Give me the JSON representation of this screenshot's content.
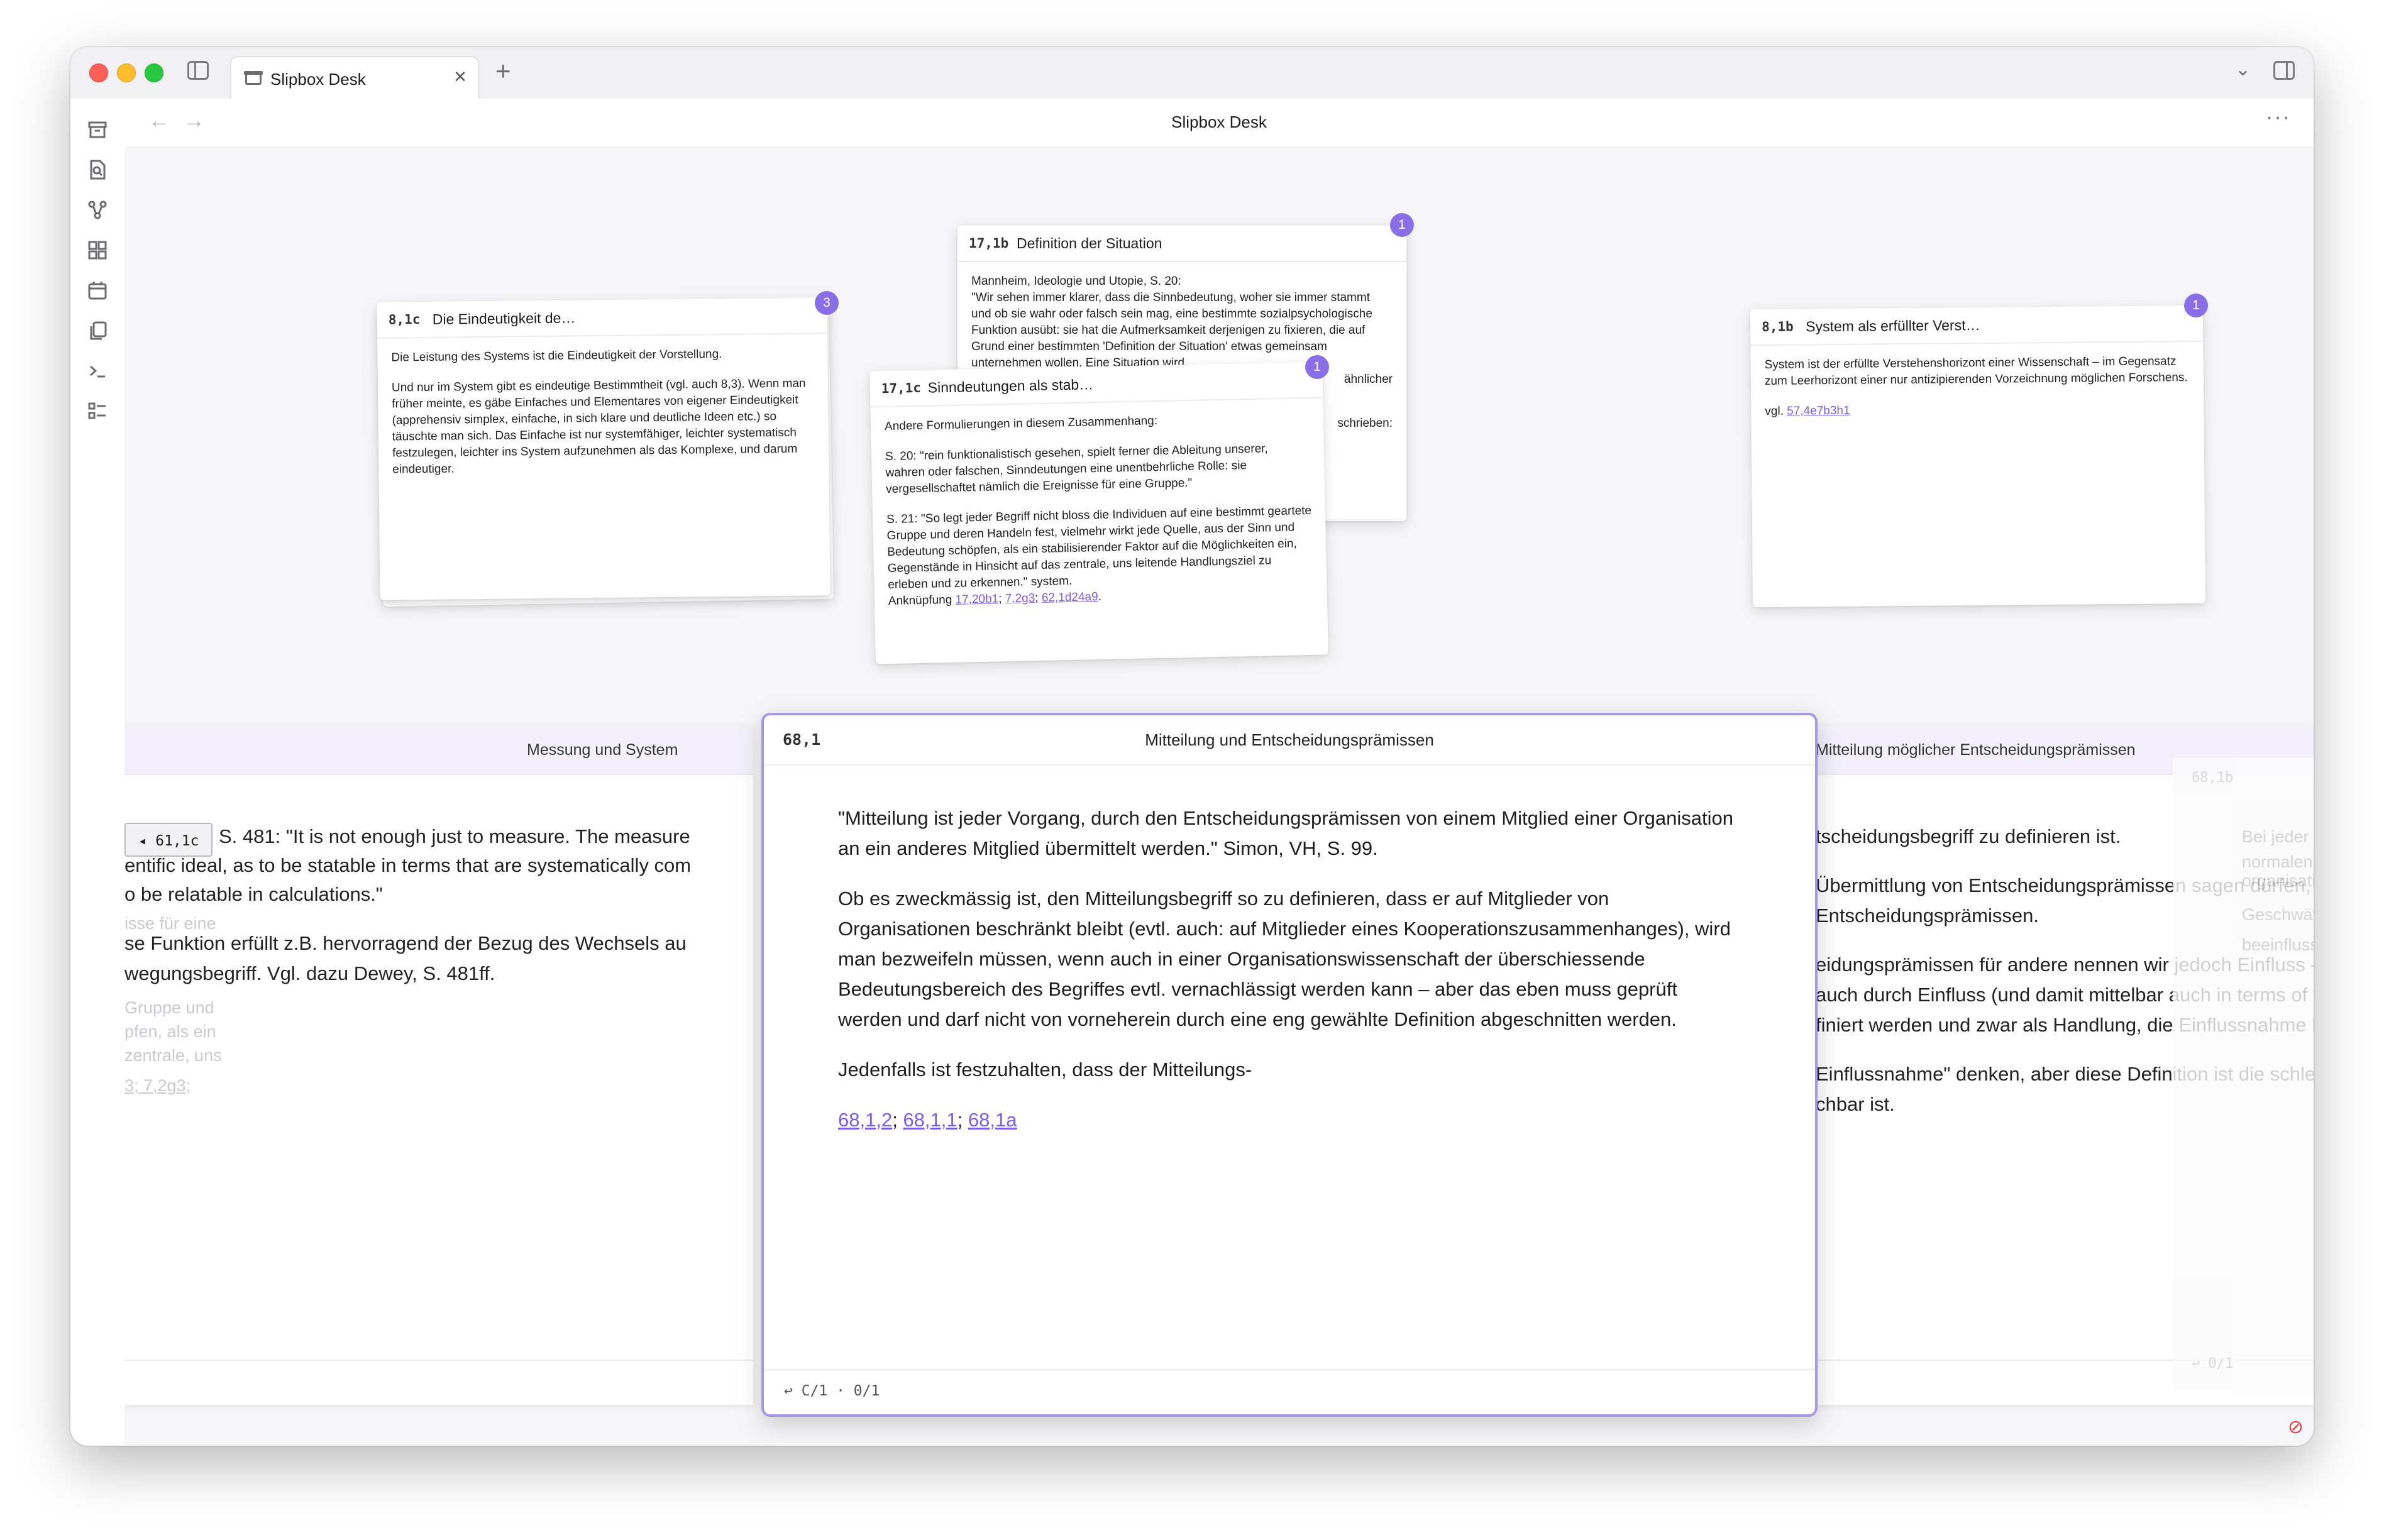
{
  "window": {
    "tab_title": "Slipbox Desk",
    "header_title": "Slipbox Desk"
  },
  "icons": {
    "tab": "archive-icon",
    "ribbon": [
      "archive-icon",
      "search-file-icon",
      "graph-icon",
      "grid-icon",
      "calendar-icon",
      "copy-icon",
      "terminal-icon",
      "list-icon"
    ]
  },
  "cards": [
    {
      "id": "8,1c",
      "title": "Die Eindeutigkeit de…",
      "badge": "3",
      "paragraphs": [
        "Die Leistung des Systems ist die Eindeutigkeit der Vorstellung.",
        "Und nur im System gibt es eindeutige Bestimmtheit (vgl. auch 8,3). Wenn man früher meinte, es gäbe Einfaches und Elementares von eigener Eindeutigkeit (apprehensiv simplex, einfache, in sich klare und deutliche Ideen etc.) so täuschte man sich. Das Einfache ist nur systemfähiger, leichter systematisch festzulegen, leichter ins System aufzunehmen als das Komplexe, und darum eindeutiger."
      ]
    },
    {
      "id": "17,1b",
      "title": "Definition der Situation",
      "badge": "1",
      "paragraphs": [
        "Mannheim, Ideologie und Utopie, S. 20:",
        "\"Wir sehen immer klarer, dass die Sinnbedeutung, woher sie immer stammt und ob sie wahr oder falsch sein mag, eine bestimmte sozialpsychologische Funktion ausübt: sie hat die Aufmerksamkeit derjenigen zu fixieren, die auf Grund einer bestimmten 'Definition der Situation' etwas gemeinsam unternehmen wollen. Eine Situation wird",
        "ähnlicher",
        "schrieben:"
      ]
    },
    {
      "id": "17,1c",
      "title": "Sinndeutungen als stab…",
      "badge": "1",
      "paragraphs": [
        "Andere Formulierungen in diesem Zusammenhang:",
        "S. 20: \"rein funktionalistisch gesehen, spielt ferner die Ableitung unserer, wahren oder falschen, Sinndeutungen eine unentbehrliche Rolle: sie vergesellschaftet nämlich die Ereignisse für eine Gruppe.\"",
        "S. 21: \"So legt jeder Begriff nicht bloss die Individuen auf eine bestimmt geartete Gruppe und deren Handeln fest, vielmehr wirkt jede Quelle, aus der Sinn und Bedeutung schöpfen, als ein stabilisierender Faktor auf die Möglichkeiten ein, Gegenstände in Hinsicht auf das zentrale, uns leitende Handlungsziel zu erleben und zu erkennen.\" system.",
        "Anknüpfung"
      ],
      "links": [
        "17,20b1",
        "7,2g3",
        "62,1d24a9"
      ]
    },
    {
      "id": "8,1b",
      "title": "System als erfüllter Verst…",
      "badge": "1",
      "paragraphs": [
        "System ist der erfüllte Verstehenshorizont einer Wissenschaft – im Gegensatz zum Leerhorizont einer nur antizipierenden Vorzeichnung möglichen Forschens.",
        "vgl."
      ],
      "links": [
        "57,4e7b3h1"
      ]
    }
  ],
  "left_pane": {
    "title": "Messung und System",
    "tag": "◂ 61,1c",
    "lines": [
      "S. 481: \"It is not enough just to measure. The measure",
      "entific ideal, as to be statable in terms that are systematically com",
      "o be relatable in calculations.\"",
      "isse für eine",
      "se Funktion erfüllt z.B. hervorragend der Bezug des Wechsels au",
      "wegungsbegriff. Vgl. dazu Dewey, S. 481ff.",
      "Gruppe und",
      "pfen, als ein",
      "zentrale, uns",
      "3; 7,2g3;"
    ]
  },
  "main_note": {
    "id": "68,1",
    "title": "Mitteilung und Entscheidungsprämissen",
    "p1": "\"Mitteilung ist jeder Vorgang, durch den Entscheidungsprämissen von einem Mitglied einer Organisation an ein anderes Mitglied übermittelt werden.\" Simon, VH, S. 99.",
    "p2": "Ob es zweckmässig ist, den Mitteilungsbegriff so zu definieren, dass er auf Mitglieder von Organisationen beschränkt bleibt (evtl. auch: auf Mitglieder eines Kooperationszusammenhanges), wird man bezweifeln müssen, wenn auch in einer Organisationswissenschaft der überschiessende Bedeutungsbereich des Begriffes evtl. vernachlässigt werden kann – aber das eben muss geprüft werden und darf nicht von vorneherein durch eine eng gewählte Definition abgeschnitten werden.",
    "p3": "Jedenfalls ist festzuhalten, dass der Mitteilungs-",
    "links": [
      "68,1,2",
      "68,1,1",
      "68,1a"
    ],
    "footer": "C/1 · 0/1"
  },
  "right_pane": {
    "title": "Mitteilung möglicher Entscheidungsprämissen",
    "lines": [
      "tscheidungsbegriff zu definieren ist.",
      "Übermittlung von Entscheidungsprämissen sagen dürfen, sonder",
      "Entscheidungsprämissen.",
      "eidungsprämissen für andere nennen wir jedoch Einfluss – vgl.",
      "auch durch Einfluss (und damit mittelbar auch in terms of the",
      "finiert werden und zwar als Handlung, die Einflussnahme bezwe",
      "Einflussnahme\" denken, aber diese Definition ist die schlechtere",
      "chbar ist."
    ]
  },
  "far_right_pane": {
    "id": "68,1b",
    "lines": [
      "Bei jeder der vo",
      "normalen Sprach",
      "organisationswis",
      "Geschwätz den C",
      "beeinflussen, w"
    ],
    "footer": "↩ 0/1"
  }
}
